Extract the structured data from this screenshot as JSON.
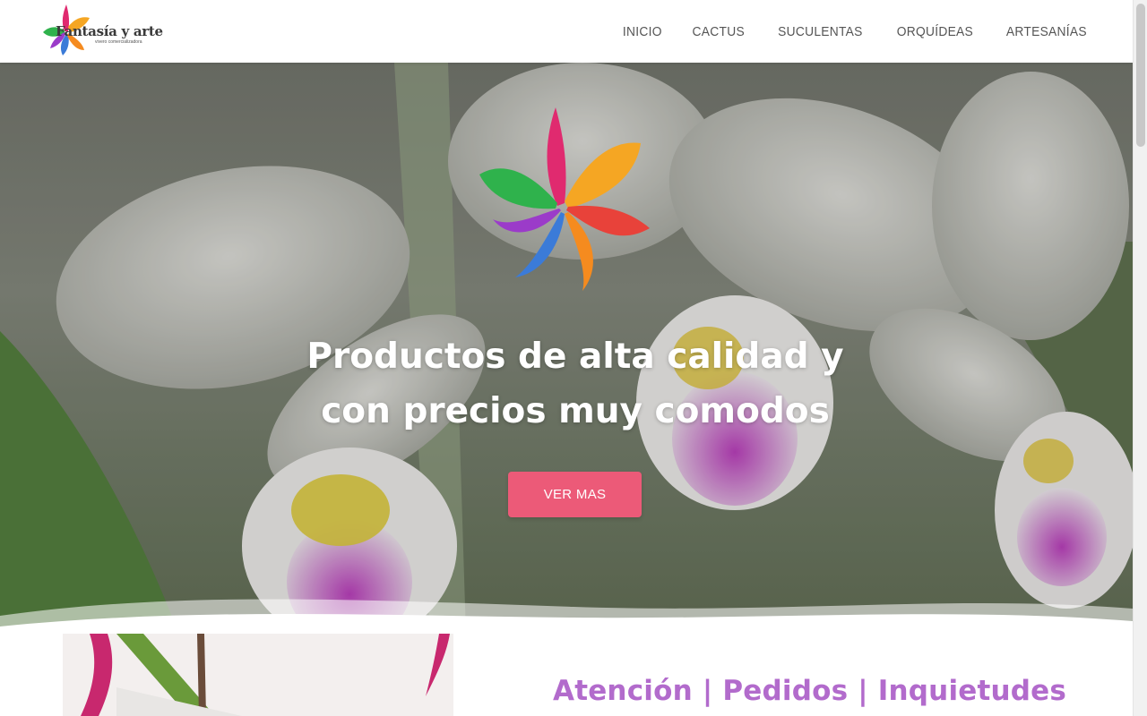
{
  "brand": {
    "name": "Fantasía y arte",
    "tagline": "vivero comercializadora"
  },
  "nav": {
    "items": [
      {
        "label": "INICIO"
      },
      {
        "label": "CACTUS"
      },
      {
        "label": "SUCULENTAS"
      },
      {
        "label": "ORQUÍDEAS"
      },
      {
        "label": "ARTESANÍAS"
      }
    ]
  },
  "hero": {
    "title_line1": "Productos de alta calidad y",
    "title_line2": "con precios muy comodos",
    "button_label": "VER MAS",
    "accent_color": "#ec5a78"
  },
  "section2": {
    "heading": "Atención | Pedidos | Inquietudes",
    "heading_color": "#b26bcc"
  }
}
